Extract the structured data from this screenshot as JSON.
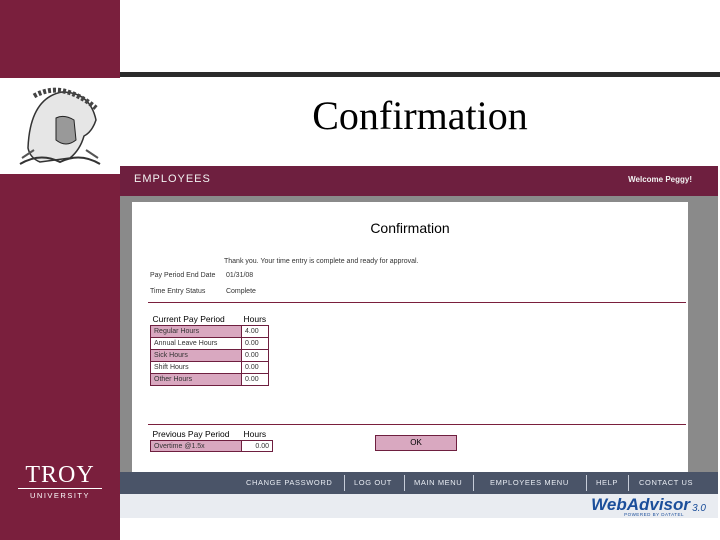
{
  "slide": {
    "title": "Confirmation",
    "logo_name": "TROY",
    "logo_sub": "UNIVERSITY"
  },
  "header": {
    "module": "EMPLOYEES",
    "welcome": "Welcome Peggy!"
  },
  "page": {
    "title": "Confirmation",
    "message": "Thank you. Your time entry is complete and ready for approval.",
    "end_date_label": "Pay Period End Date",
    "end_date_value": "01/31/08",
    "status_label": "Time Entry Status",
    "status_value": "Complete"
  },
  "current_period": {
    "header": "Current Pay Period",
    "hours_header": "Hours",
    "rows": [
      {
        "label": "Regular Hours",
        "value": "4.00"
      },
      {
        "label": "Annual Leave Hours",
        "value": "0.00"
      },
      {
        "label": "Sick Hours",
        "value": "0.00"
      },
      {
        "label": "Shift Hours",
        "value": "0.00"
      },
      {
        "label": "Other Hours",
        "value": "0.00"
      }
    ]
  },
  "previous_period": {
    "header": "Previous Pay Period",
    "hours_header": "Hours",
    "rows": [
      {
        "label": "Overtime @1.5x",
        "value": "0.00"
      }
    ]
  },
  "actions": {
    "ok_label": "OK"
  },
  "nav": {
    "items": [
      "CHANGE PASSWORD",
      "LOG OUT",
      "MAIN MENU",
      "EMPLOYEES MENU",
      "HELP",
      "CONTACT US"
    ]
  },
  "footer": {
    "brand": "WebAdvisor",
    "version": "3.0",
    "powered": "POWERED BY DATATEL"
  },
  "colors": {
    "maroon": "#7a1f3d",
    "pink": "#d9a8c0",
    "nav": "#4a5468",
    "brand_blue": "#1b4e9a"
  }
}
